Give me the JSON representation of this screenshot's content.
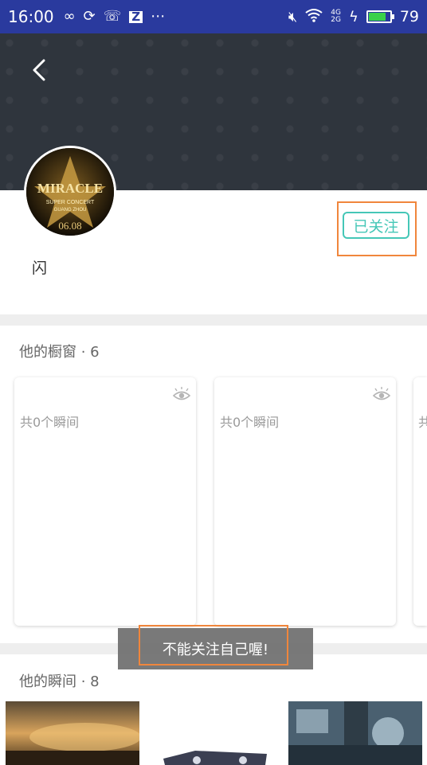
{
  "status_bar": {
    "time": "16:00",
    "battery": "79",
    "battery_level": 0.79,
    "left_icons": [
      "infinity-icon",
      "sync-icon",
      "missed-call-icon",
      "z-app-icon",
      "more-icon"
    ],
    "right_icons": [
      "mute-icon",
      "wifi-icon",
      "signal-icon",
      "charging-icon"
    ]
  },
  "profile": {
    "name": "闪",
    "follow_button": "已关注",
    "avatar_text": [
      "MIRACLE",
      "SUPER CONCERT",
      "GUANG ZHOU",
      "06.08"
    ]
  },
  "showcase": {
    "title": "他的橱窗 · 6",
    "cards": [
      {
        "count": "共0个瞬间"
      },
      {
        "count": "共0个瞬间"
      },
      {
        "count": "共"
      }
    ]
  },
  "toast": {
    "message": "不能关注自己喔!"
  },
  "moments": {
    "title": "他的瞬间 · 8"
  },
  "colors": {
    "status_bar": "#2a3a9e",
    "accent": "#45c7b7",
    "highlight": "#f0863c",
    "banner": "#2f353d"
  }
}
